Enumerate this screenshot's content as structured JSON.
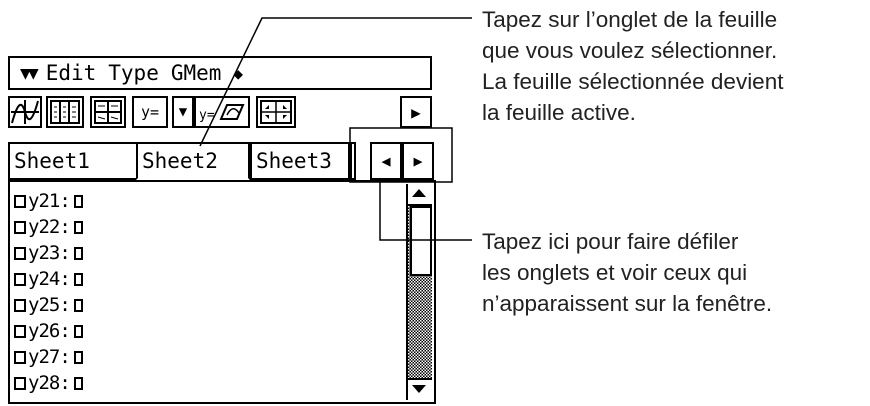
{
  "menubar": {
    "items": [
      "Edit",
      "Type",
      "GMem"
    ]
  },
  "toolbar": {
    "y_equals_label": "y="
  },
  "tabs": [
    {
      "label": "Sheet1",
      "active": false
    },
    {
      "label": "Sheet2",
      "active": true
    },
    {
      "label": "Sheet3",
      "active": false
    }
  ],
  "list": {
    "rows": [
      "y21:",
      "y22:",
      "y23:",
      "y24:",
      "y25:",
      "y26:",
      "y27:",
      "y28:"
    ]
  },
  "callouts": {
    "top": [
      "Tapez sur l’onglet de la feuille",
      "que vous voulez sélectionner.",
      "La feuille sélectionnée devient",
      "la feuille active."
    ],
    "bottom": [
      "Tapez ici pour faire défiler",
      "les onglets et voir ceux qui",
      "n’apparaissent sur la fenêtre."
    ]
  }
}
